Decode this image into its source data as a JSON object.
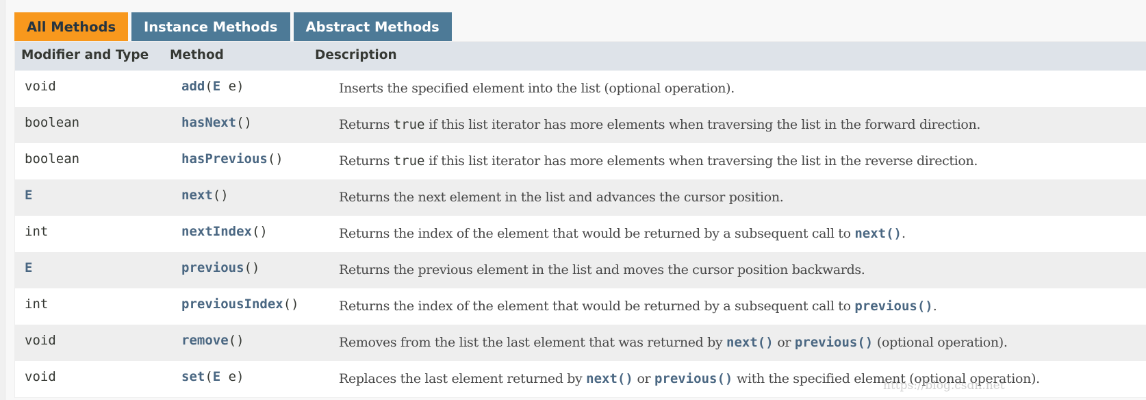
{
  "tabs": [
    {
      "label": "All Methods",
      "active": true
    },
    {
      "label": "Instance Methods",
      "active": false
    },
    {
      "label": "Abstract Methods",
      "active": false
    }
  ],
  "columns": {
    "modifier_type": "Modifier and Type",
    "method": "Method",
    "description": "Description"
  },
  "rows": [
    {
      "type": "void",
      "type_link": false,
      "method": "add",
      "params": [
        {
          "text": "("
        },
        {
          "text": "E",
          "link": true
        },
        {
          "text": " e)"
        }
      ],
      "description": [
        {
          "text": "Inserts the specified element into the list (optional operation)."
        }
      ]
    },
    {
      "type": "boolean",
      "type_link": false,
      "method": "hasNext",
      "params": [
        {
          "text": "()"
        }
      ],
      "description": [
        {
          "text": "Returns "
        },
        {
          "text": "true",
          "code": true
        },
        {
          "text": " if this list iterator has more elements when traversing the list in the forward direction."
        }
      ]
    },
    {
      "type": "boolean",
      "type_link": false,
      "method": "hasPrevious",
      "params": [
        {
          "text": "()"
        }
      ],
      "description": [
        {
          "text": "Returns "
        },
        {
          "text": "true",
          "code": true
        },
        {
          "text": " if this list iterator has more elements when traversing the list in the reverse direction."
        }
      ]
    },
    {
      "type": "E",
      "type_link": true,
      "method": "next",
      "params": [
        {
          "text": "()"
        }
      ],
      "description": [
        {
          "text": "Returns the next element in the list and advances the cursor position."
        }
      ]
    },
    {
      "type": "int",
      "type_link": false,
      "method": "nextIndex",
      "params": [
        {
          "text": "()"
        }
      ],
      "description": [
        {
          "text": "Returns the index of the element that would be returned by a subsequent call to "
        },
        {
          "text": "next()",
          "code": true,
          "link": true
        },
        {
          "text": "."
        }
      ]
    },
    {
      "type": "E",
      "type_link": true,
      "method": "previous",
      "params": [
        {
          "text": "()"
        }
      ],
      "description": [
        {
          "text": "Returns the previous element in the list and moves the cursor position backwards."
        }
      ]
    },
    {
      "type": "int",
      "type_link": false,
      "method": "previousIndex",
      "params": [
        {
          "text": "()"
        }
      ],
      "description": [
        {
          "text": "Returns the index of the element that would be returned by a subsequent call to "
        },
        {
          "text": "previous()",
          "code": true,
          "link": true
        },
        {
          "text": "."
        }
      ]
    },
    {
      "type": "void",
      "type_link": false,
      "method": "remove",
      "params": [
        {
          "text": "()"
        }
      ],
      "description": [
        {
          "text": "Removes from the list the last element that was returned by "
        },
        {
          "text": "next()",
          "code": true,
          "link": true
        },
        {
          "text": " or "
        },
        {
          "text": "previous()",
          "code": true,
          "link": true
        },
        {
          "text": " (optional operation)."
        }
      ]
    },
    {
      "type": "void",
      "type_link": false,
      "method": "set",
      "params": [
        {
          "text": "("
        },
        {
          "text": "E",
          "link": true
        },
        {
          "text": " e)"
        }
      ],
      "description": [
        {
          "text": "Replaces the last element returned by "
        },
        {
          "text": "next()",
          "code": true,
          "link": true
        },
        {
          "text": " or "
        },
        {
          "text": "previous()",
          "code": true,
          "link": true
        },
        {
          "text": " with the specified element (optional operation)."
        }
      ]
    }
  ],
  "watermark": "https://blog.csdn.net",
  "colors": {
    "tab_active_bg": "#f8981d",
    "tab_bg": "#4d7a97",
    "header_bg": "#dee3e9",
    "row_alt_bg": "#eeeeee",
    "link": "#4a6782"
  }
}
